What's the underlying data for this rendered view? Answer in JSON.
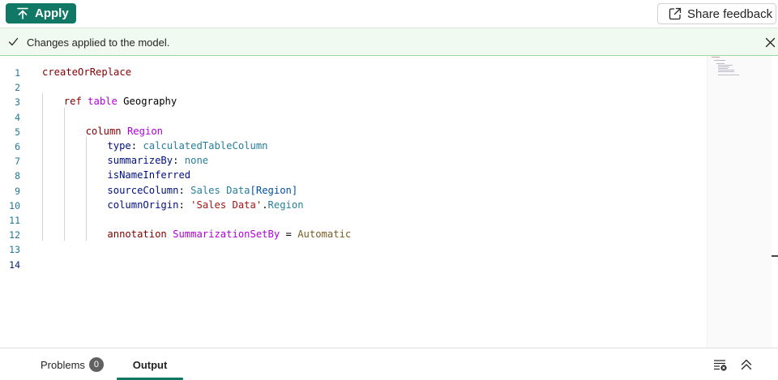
{
  "toolbar": {
    "apply_label": "Apply",
    "feedback_label": "Share feedback"
  },
  "banner": {
    "message": "Changes applied to the model."
  },
  "editor": {
    "line_numbers": [
      "1",
      "2",
      "3",
      "4",
      "5",
      "6",
      "7",
      "8",
      "9",
      "10",
      "11",
      "12",
      "13",
      "14"
    ],
    "lines": [
      {
        "n": "1",
        "tokens": [
          {
            "c": "kw",
            "t": "createOrReplace"
          }
        ]
      },
      {
        "n": "2",
        "tokens": []
      },
      {
        "n": "3",
        "tokens": [
          {
            "c": "kw",
            "t": "ref"
          },
          {
            "c": "",
            "t": " "
          },
          {
            "c": "kw2",
            "t": "table"
          },
          {
            "c": "",
            "t": " Geography"
          }
        ]
      },
      {
        "n": "4",
        "tokens": []
      },
      {
        "n": "5",
        "tokens": [
          {
            "c": "kw",
            "t": "column"
          },
          {
            "c": "",
            "t": " "
          },
          {
            "c": "kw2",
            "t": "Region"
          }
        ]
      },
      {
        "n": "6",
        "tokens": [
          {
            "c": "prop",
            "t": "type"
          },
          {
            "c": "",
            "t": ": "
          },
          {
            "c": "val",
            "t": "calculatedTableColumn"
          }
        ]
      },
      {
        "n": "7",
        "tokens": [
          {
            "c": "prop",
            "t": "summarizeBy"
          },
          {
            "c": "",
            "t": ": "
          },
          {
            "c": "val",
            "t": "none"
          }
        ]
      },
      {
        "n": "8",
        "tokens": [
          {
            "c": "prop",
            "t": "isNameInferred"
          }
        ]
      },
      {
        "n": "9",
        "tokens": [
          {
            "c": "prop",
            "t": "sourceColumn"
          },
          {
            "c": "",
            "t": ": "
          },
          {
            "c": "val",
            "t": "Sales Data"
          },
          {
            "c": "br",
            "t": "[Region]"
          }
        ]
      },
      {
        "n": "10",
        "tokens": [
          {
            "c": "prop",
            "t": "columnOrigin"
          },
          {
            "c": "",
            "t": ": "
          },
          {
            "c": "str",
            "t": "'Sales Data'"
          },
          {
            "c": "",
            "t": "."
          },
          {
            "c": "val",
            "t": "Region"
          }
        ]
      },
      {
        "n": "11",
        "tokens": []
      },
      {
        "n": "12",
        "tokens": [
          {
            "c": "kw",
            "t": "annotation"
          },
          {
            "c": "",
            "t": " "
          },
          {
            "c": "kw2",
            "t": "SummarizationSetBy"
          },
          {
            "c": "",
            "t": " = "
          },
          {
            "c": "en",
            "t": "Automatic"
          }
        ]
      },
      {
        "n": "13",
        "tokens": []
      },
      {
        "n": "14",
        "tokens": []
      }
    ]
  },
  "panel": {
    "problems_label": "Problems",
    "problems_count": "0",
    "output_label": "Output"
  },
  "colors": {
    "accent": "#117865",
    "banner_bg": "#f1faf1"
  },
  "icons": [
    "arrow-upload-icon",
    "share-icon",
    "checkmark-icon",
    "close-icon",
    "clear-output-icon",
    "chevron-double-up-icon"
  ]
}
